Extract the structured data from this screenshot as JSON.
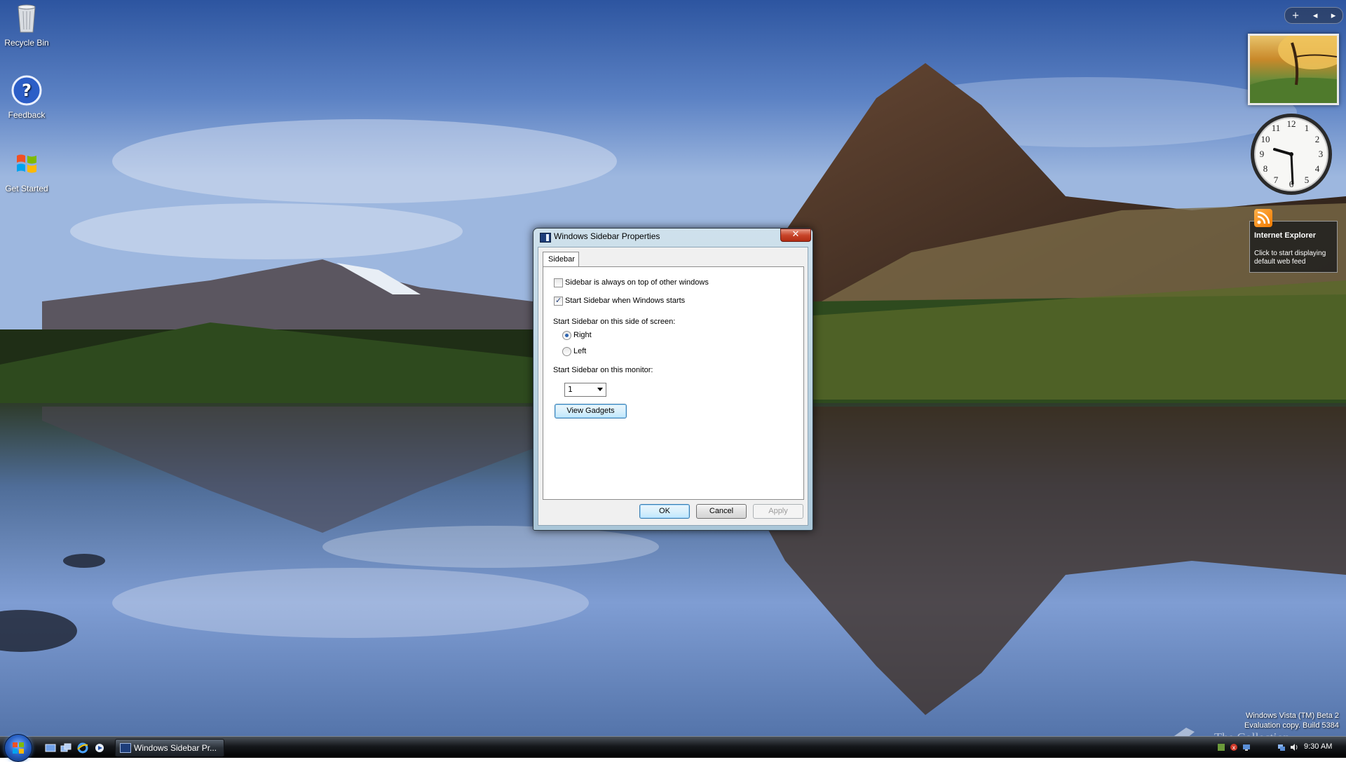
{
  "desktop": {
    "icons": [
      {
        "label": "Recycle Bin",
        "icon": "recycle-bin-icon"
      },
      {
        "label": "Feedback",
        "icon": "help-icon"
      },
      {
        "label": "Get Started",
        "icon": "windows-logo-icon"
      }
    ]
  },
  "sidebar": {
    "controls": {
      "add": "+",
      "prev": "◂",
      "next": "▸"
    },
    "feed": {
      "title": "Internet Explorer",
      "message": "Click to start displaying default web feed"
    }
  },
  "dialog": {
    "title": "Windows Sidebar Properties",
    "close_label": "✕",
    "tab_label": "Sidebar",
    "always_on_top_label": "Sidebar is always on top of other windows",
    "always_on_top_checked": false,
    "start_with_windows_label": "Start Sidebar when Windows starts",
    "start_with_windows_checked": true,
    "side_heading": "Start Sidebar on this side of screen:",
    "side_options": [
      "Right",
      "Left"
    ],
    "side_selected": "Right",
    "monitor_heading": "Start Sidebar on this monitor:",
    "monitor_value": "1",
    "view_gadgets_label": "View Gadgets",
    "ok_label": "OK",
    "cancel_label": "Cancel",
    "apply_label": "Apply"
  },
  "taskbar": {
    "task_button_label": "Windows Sidebar Pr...",
    "clock": "9:30 AM"
  },
  "watermark": {
    "line1": "Windows Vista (TM) Beta 2",
    "line2": "Evaluation copy. Build 5384",
    "book": "The Collection Book"
  },
  "colors": {
    "dialog_frame": "#a9c6d8",
    "close_button": "#c8452a",
    "default_button": "#3c7fb1",
    "taskbar": "#15181c"
  }
}
